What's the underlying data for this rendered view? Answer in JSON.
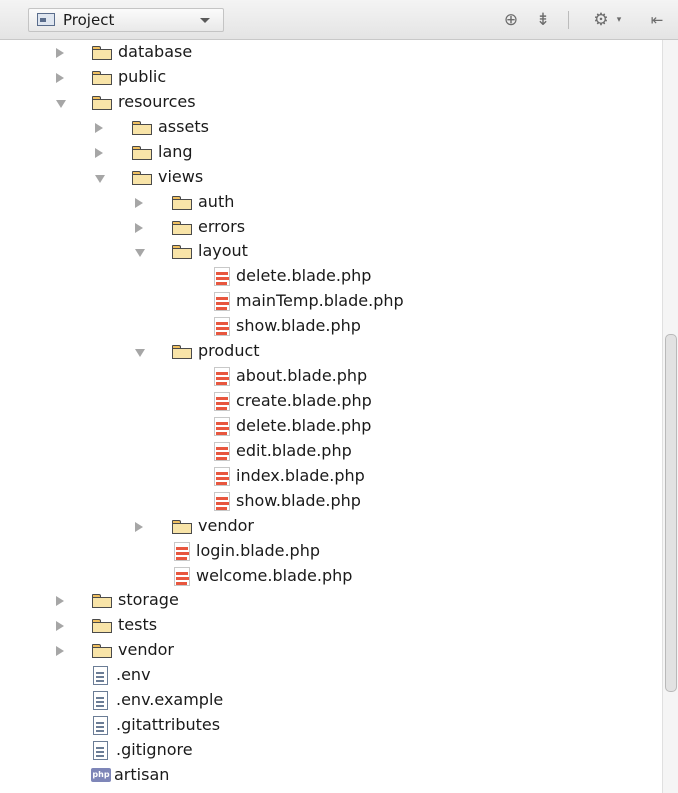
{
  "toolbar": {
    "view_label": "Project",
    "icons": [
      "project-view-icon",
      "dropdown-caret-icon",
      "locate-target-icon",
      "collapse-all-icon",
      "gear-icon",
      "gear-dropdown-icon",
      "hide-panel-icon"
    ]
  },
  "tree": {
    "items": [
      {
        "label": "database",
        "type": "folder",
        "depth": 1,
        "state": "collapsed"
      },
      {
        "label": "public",
        "type": "folder",
        "depth": 1,
        "state": "collapsed"
      },
      {
        "label": "resources",
        "type": "folder",
        "depth": 1,
        "state": "expanded"
      },
      {
        "label": "assets",
        "type": "folder",
        "depth": 2,
        "state": "collapsed"
      },
      {
        "label": "lang",
        "type": "folder",
        "depth": 2,
        "state": "collapsed"
      },
      {
        "label": "views",
        "type": "folder",
        "depth": 2,
        "state": "expanded"
      },
      {
        "label": "auth",
        "type": "folder",
        "depth": 3,
        "state": "collapsed"
      },
      {
        "label": "errors",
        "type": "folder",
        "depth": 3,
        "state": "collapsed"
      },
      {
        "label": "layout",
        "type": "folder",
        "depth": 3,
        "state": "expanded"
      },
      {
        "label": "delete.blade.php",
        "type": "blade",
        "depth": 4
      },
      {
        "label": "mainTemp.blade.php",
        "type": "blade",
        "depth": 4
      },
      {
        "label": "show.blade.php",
        "type": "blade",
        "depth": 4
      },
      {
        "label": "product",
        "type": "folder",
        "depth": 3,
        "state": "expanded"
      },
      {
        "label": "about.blade.php",
        "type": "blade",
        "depth": 4
      },
      {
        "label": "create.blade.php",
        "type": "blade",
        "depth": 4
      },
      {
        "label": "delete.blade.php",
        "type": "blade",
        "depth": 4
      },
      {
        "label": "edit.blade.php",
        "type": "blade",
        "depth": 4
      },
      {
        "label": "index.blade.php",
        "type": "blade",
        "depth": 4
      },
      {
        "label": "show.blade.php",
        "type": "blade",
        "depth": 4
      },
      {
        "label": "vendor",
        "type": "folder",
        "depth": 3,
        "state": "collapsed"
      },
      {
        "label": "login.blade.php",
        "type": "blade",
        "depth": 3
      },
      {
        "label": "welcome.blade.php",
        "type": "blade",
        "depth": 3
      },
      {
        "label": "storage",
        "type": "folder",
        "depth": 1,
        "state": "collapsed"
      },
      {
        "label": "tests",
        "type": "folder",
        "depth": 1,
        "state": "collapsed"
      },
      {
        "label": "vendor",
        "type": "folder",
        "depth": 1,
        "state": "collapsed"
      },
      {
        "label": ".env",
        "type": "text",
        "depth": 1
      },
      {
        "label": ".env.example",
        "type": "text",
        "depth": 1
      },
      {
        "label": ".gitattributes",
        "type": "text",
        "depth": 1
      },
      {
        "label": ".gitignore",
        "type": "text",
        "depth": 1
      },
      {
        "label": "artisan",
        "type": "php",
        "depth": 1
      }
    ]
  },
  "colors": {
    "toolbar_bg": "#e8e8e8",
    "folder_fill": "#f8e4a8",
    "blade_accent": "#e8563e",
    "text": "#1a1a1a",
    "arrow": "#a6a6a6"
  }
}
